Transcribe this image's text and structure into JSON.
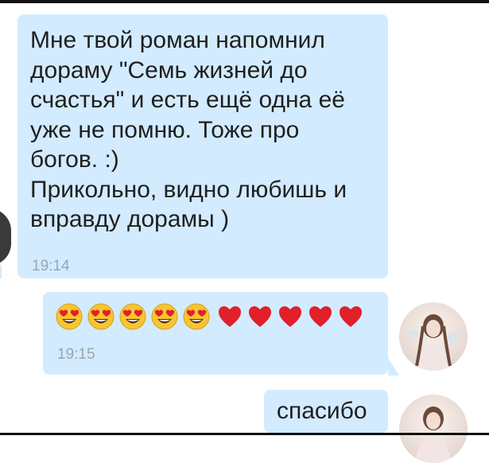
{
  "messages": [
    {
      "direction": "incoming",
      "text": "Мне твой роман напомнил\nдораму \"Семь жизней до\nсчастья\" и есть ещё одна её\nуже не помню. Тоже про\nбогов. :)\nПрикольно, видно любишь и\nвправду дорамы )",
      "time": "19:14"
    },
    {
      "direction": "outgoing",
      "emoji": [
        "heart-eyes-face",
        "heart-eyes-face",
        "heart-eyes-face",
        "heart-eyes-face",
        "heart-eyes-face",
        "red-heart",
        "red-heart",
        "red-heart",
        "red-heart",
        "red-heart"
      ],
      "time": "19:15"
    },
    {
      "direction": "outgoing",
      "text": "спасибо"
    }
  ],
  "colors": {
    "bubble": "#d3ebff",
    "text": "#1f1f1f",
    "time": "#9aa6b0",
    "heart": "#e0202a"
  }
}
